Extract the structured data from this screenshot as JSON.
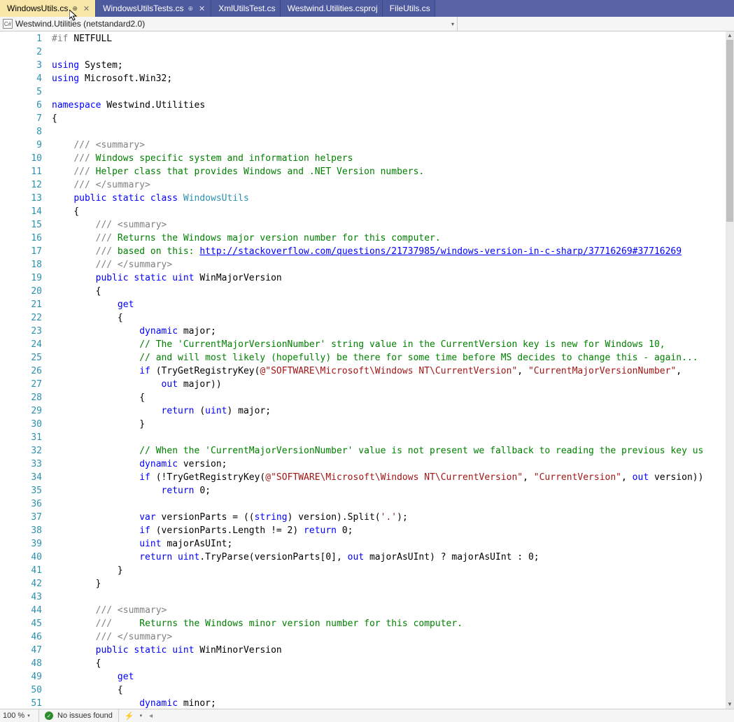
{
  "tabs": [
    {
      "label": "WindowsUtils.cs",
      "active": true,
      "pinned": true,
      "closable": true
    },
    {
      "label": "WindowsUtilsTests.cs",
      "active": false,
      "pinned": true,
      "closable": true
    },
    {
      "label": "XmlUtilsTest.cs",
      "active": false,
      "pinned": false,
      "closable": false
    },
    {
      "label": "Westwind.Utilities.csproj",
      "active": false,
      "pinned": false,
      "closable": false
    },
    {
      "label": "FileUtils.cs",
      "active": false,
      "pinned": false,
      "closable": false
    }
  ],
  "navbar": {
    "scope": "Westwind.Utilities (netstandard2.0)"
  },
  "status": {
    "zoom": "100 %",
    "issues": "No issues found"
  },
  "glyphs": {
    "pin": "⊕",
    "close": "✕",
    "dropdown": "▾",
    "check": "✓",
    "lightning": "⚡",
    "caret_left": "◂",
    "arrow_up": "▲",
    "arrow_down": "▼"
  },
  "lines": [
    "<span class='pre'>#if</span> <span class='preval'>NETFULL</span>",
    "",
    "<span class='kw'>using</span> System;",
    "<span class='kw'>using</span> Microsoft.Win32;",
    "",
    "<span class='kw'>namespace</span> Westwind.Utilities",
    "{",
    "",
    "    <span class='doc'>/// &lt;summary&gt;</span>",
    "    <span class='doc'>///</span><span class='cmt'> Windows specific system and information helpers</span>",
    "    <span class='doc'>///</span><span class='cmt'> Helper class that provides Windows and .NET Version numbers.</span>",
    "    <span class='doc'>/// &lt;/summary&gt;</span>",
    "    <span class='kw'>public</span> <span class='kw'>static</span> <span class='kw'>class</span> <span class='cls'>WindowsUtils</span>",
    "    {",
    "        <span class='doc'>/// &lt;summary&gt;</span>",
    "        <span class='doc'>///</span><span class='cmt'> Returns the Windows major version number for this computer.</span>",
    "        <span class='doc'>///</span><span class='cmt'> based on this: </span><span class='lnk'>http://stackoverflow.com/questions/21737985/windows-version-in-c-sharp/37716269#37716269</span>",
    "        <span class='doc'>/// &lt;/summary&gt;</span>",
    "        <span class='kw'>public</span> <span class='kw'>static</span> <span class='kw'>uint</span> WinMajorVersion",
    "        {",
    "            <span class='kw'>get</span>",
    "            {",
    "                <span class='kw'>dynamic</span> major;",
    "                <span class='cmt'>// The 'CurrentMajorVersionNumber' string value in the CurrentVersion key is new for Windows 10,</span>",
    "                <span class='cmt'>// and will most likely (hopefully) be there for some time before MS decides to change this - again...</span>",
    "                <span class='kw'>if</span> (TryGetRegistryKey(<span class='str'>@\"SOFTWARE\\Microsoft\\Windows NT\\CurrentVersion\"</span>, <span class='str'>\"CurrentMajorVersionNumber\"</span>,",
    "                    <span class='kw'>out</span> major))",
    "                {",
    "                    <span class='kw'>return</span> (<span class='kw'>uint</span>) major;",
    "                }",
    "",
    "                <span class='cmt'>// When the 'CurrentMajorVersionNumber' value is not present we fallback to reading the previous key us</span>",
    "                <span class='kw'>dynamic</span> version;",
    "                <span class='kw'>if</span> (!TryGetRegistryKey(<span class='str'>@\"SOFTWARE\\Microsoft\\Windows NT\\CurrentVersion\"</span>, <span class='str'>\"CurrentVersion\"</span>, <span class='kw'>out</span> version))",
    "                    <span class='kw'>return</span> 0;",
    "",
    "                <span class='kw'>var</span> versionParts = ((<span class='kw'>string</span>) version).Split(<span class='str'>'.'</span>);",
    "                <span class='kw'>if</span> (versionParts.Length != 2) <span class='kw'>return</span> 0;",
    "                <span class='kw'>uint</span> majorAsUInt;",
    "                <span class='kw'>return</span> <span class='kw'>uint</span>.TryParse(versionParts[0], <span class='kw'>out</span> majorAsUInt) ? majorAsUInt : 0;",
    "            }",
    "        }",
    "",
    "        <span class='doc'>/// &lt;summary&gt;</span>",
    "        <span class='doc'>///</span><span class='cmt'>     Returns the Windows minor version number for this computer.</span>",
    "        <span class='doc'>/// &lt;/summary&gt;</span>",
    "        <span class='kw'>public</span> <span class='kw'>static</span> <span class='kw'>uint</span> WinMinorVersion",
    "        {",
    "            <span class='kw'>get</span>",
    "            {",
    "                <span class='kw'>dynamic</span> minor;"
  ]
}
